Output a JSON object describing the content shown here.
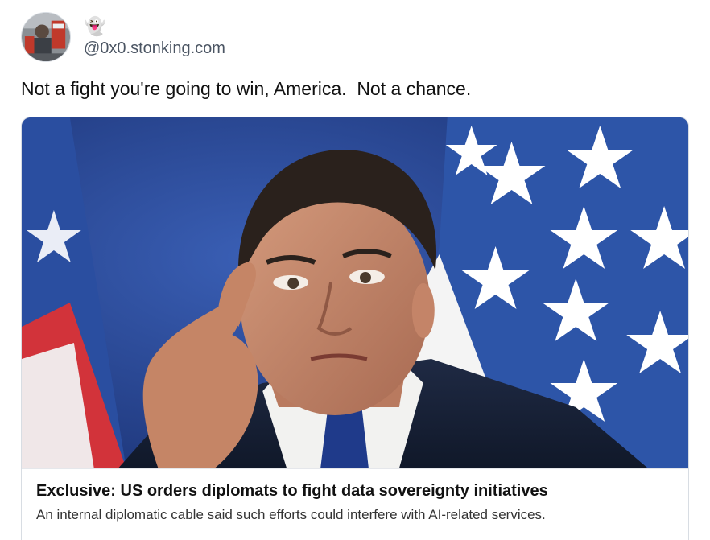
{
  "author": {
    "display_name": "👻",
    "handle": "@0x0.stonking.com"
  },
  "post": {
    "text": "Not a fight you're going to win, America.  Not a chance."
  },
  "link_card": {
    "title": "Exclusive: US orders diplomats to fight data sovereignty initiatives",
    "description": "An internal diplomatic cable said such efforts could interfere with AI-related services."
  },
  "colors": {
    "flag_blue": "#2f4a8c",
    "flag_red": "#d2333a",
    "text_secondary": "#4b5563",
    "card_border": "#d8dde3"
  },
  "icons": {
    "avatar": "avatar-photo",
    "display_name_emoji": "ghost-emoji"
  }
}
